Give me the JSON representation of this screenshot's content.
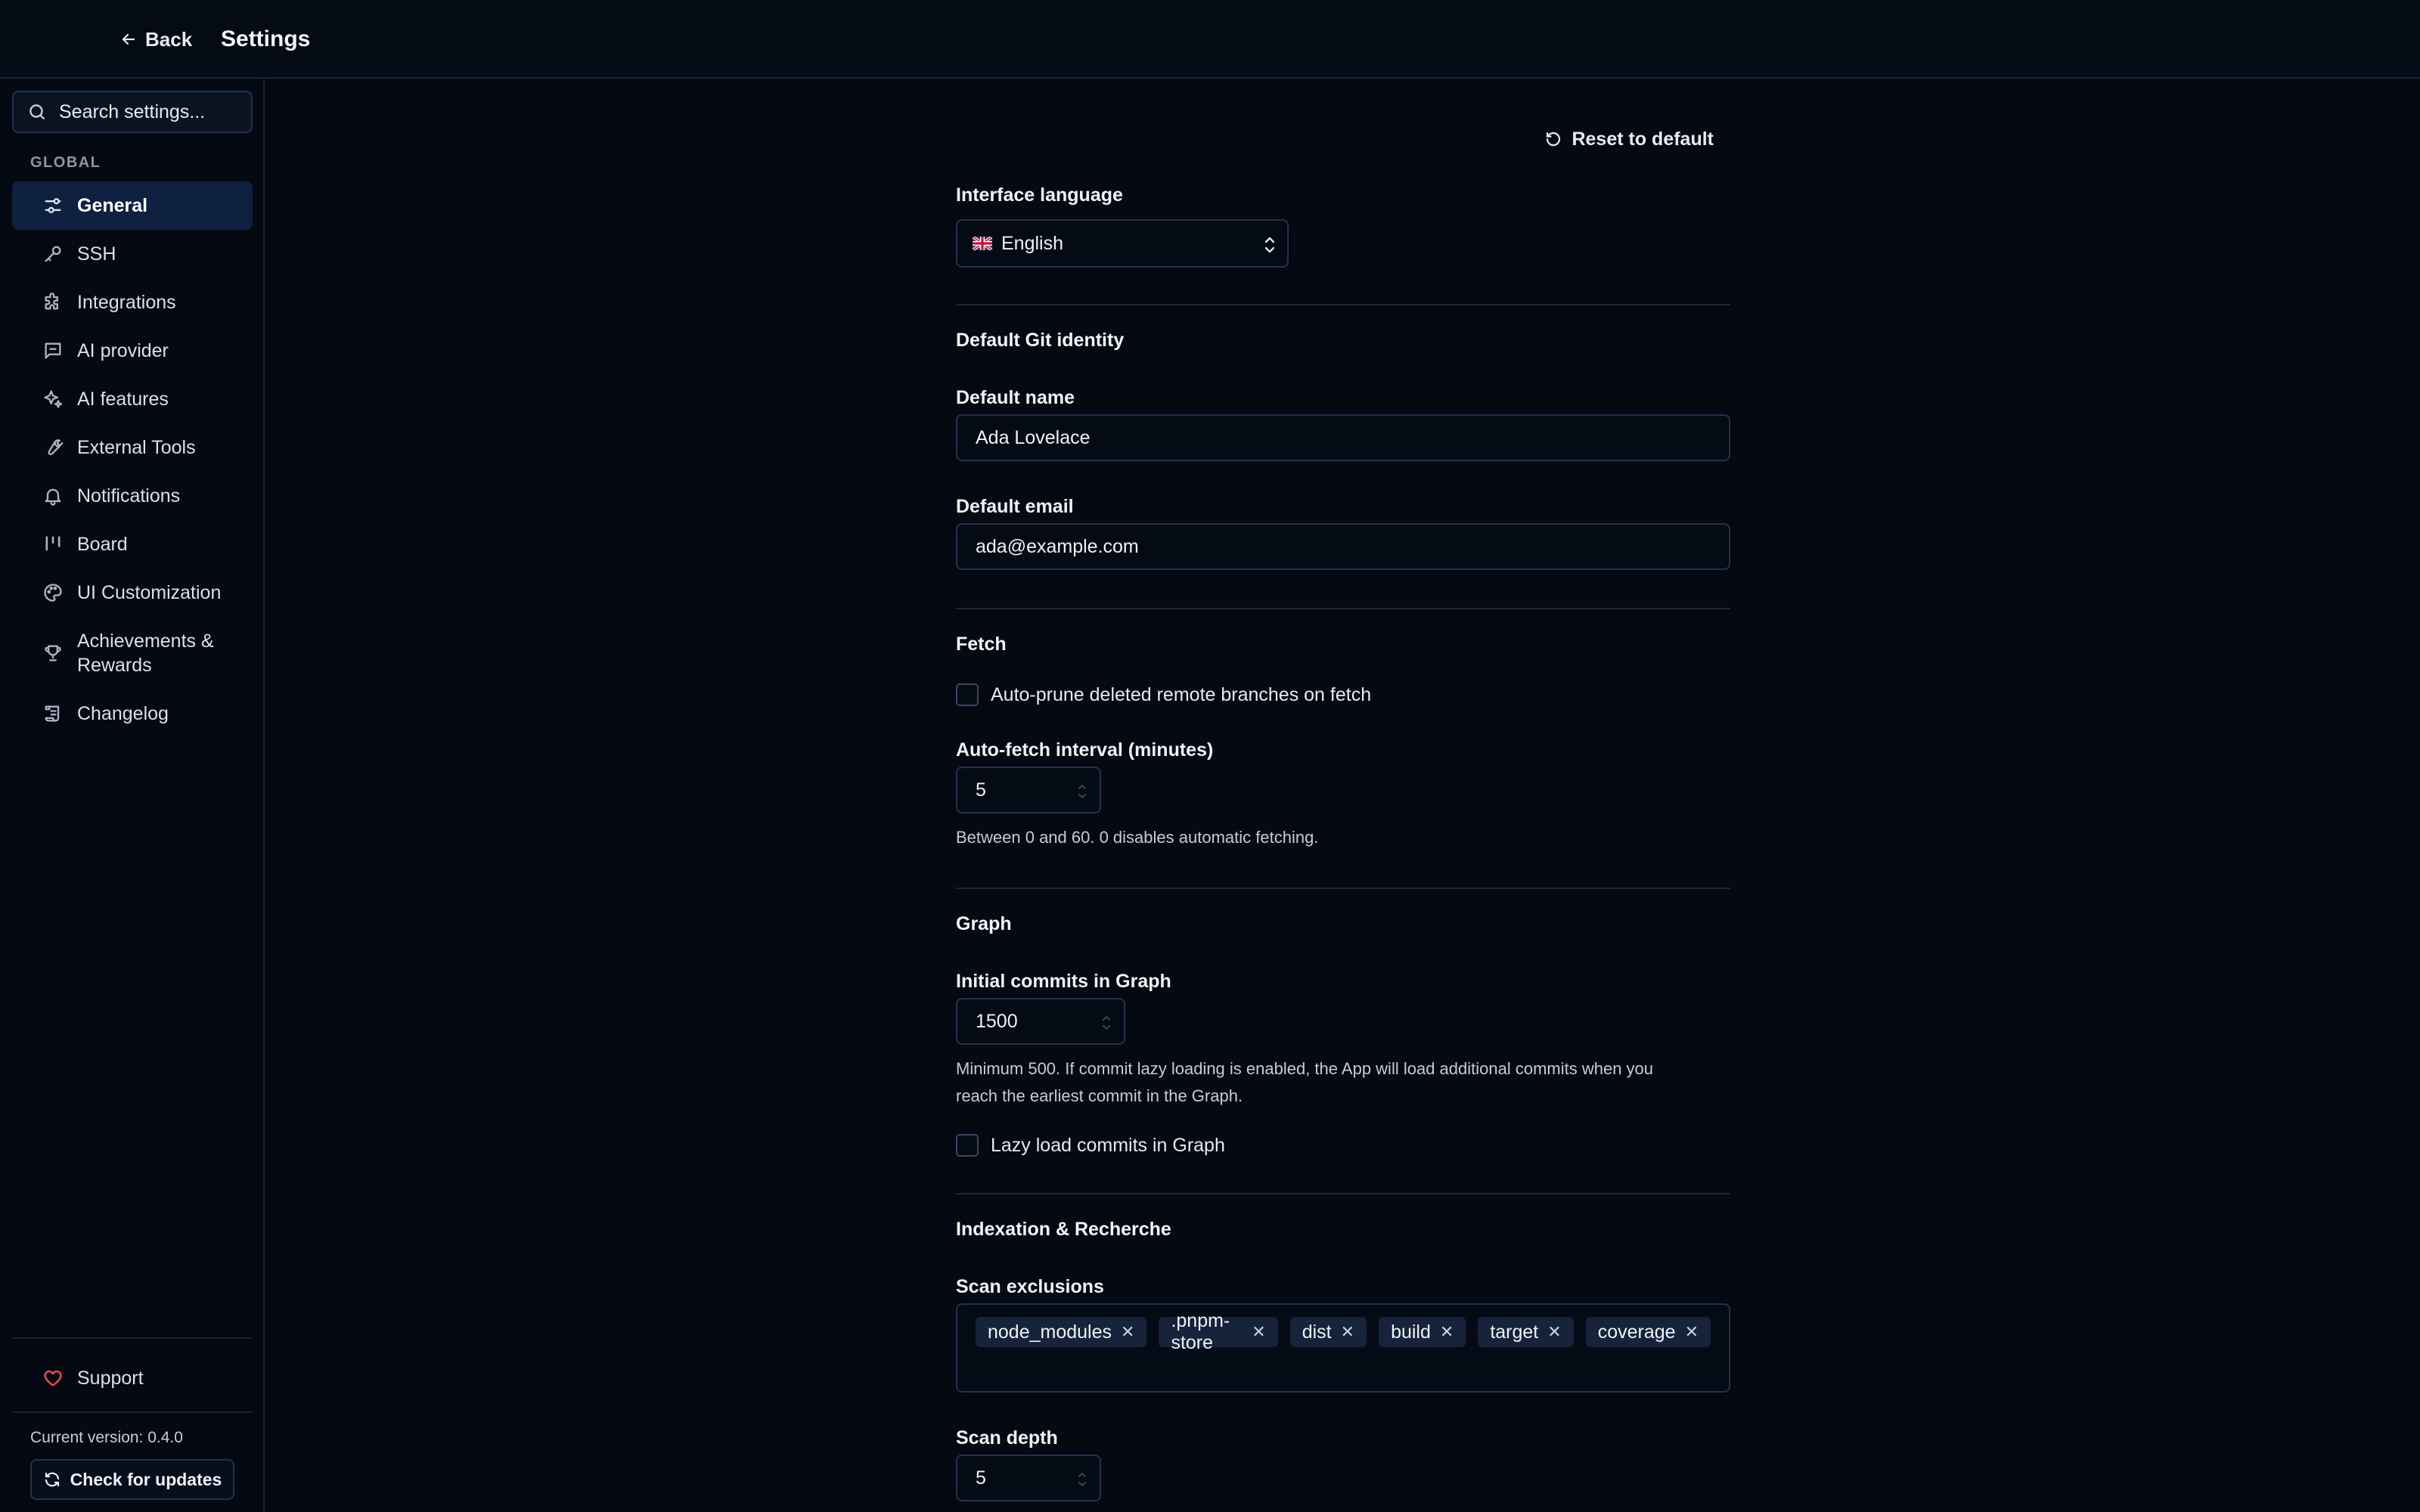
{
  "header": {
    "back_label": "Back",
    "title": "Settings"
  },
  "sidebar": {
    "search_placeholder": "Search settings...",
    "group_label": "GLOBAL",
    "items": [
      {
        "label": "General",
        "icon": "sliders-icon",
        "active": true
      },
      {
        "label": "SSH",
        "icon": "key-icon"
      },
      {
        "label": "Integrations",
        "icon": "puzzle-icon"
      },
      {
        "label": "AI provider",
        "icon": "message-square-icon"
      },
      {
        "label": "AI features",
        "icon": "sparkles-icon"
      },
      {
        "label": "External Tools",
        "icon": "wrench-icon"
      },
      {
        "label": "Notifications",
        "icon": "bell-icon"
      },
      {
        "label": "Board",
        "icon": "kanban-icon"
      },
      {
        "label": "UI Customization",
        "icon": "palette-icon"
      },
      {
        "label": "Achievements & Rewards",
        "icon": "trophy-icon"
      },
      {
        "label": "Changelog",
        "icon": "scroll-icon"
      }
    ],
    "support_label": "Support",
    "version_text": "Current version: 0.4.0",
    "check_updates_label": "Check for updates"
  },
  "main": {
    "reset_label": "Reset to default",
    "language": {
      "label": "Interface language",
      "value": "English"
    },
    "git_identity": {
      "title": "Default Git identity",
      "name_label": "Default name",
      "name_value": "Ada Lovelace",
      "email_label": "Default email",
      "email_value": "ada@example.com"
    },
    "fetch": {
      "title": "Fetch",
      "auto_prune_label": "Auto-prune deleted remote branches on fetch",
      "auto_prune_checked": false,
      "interval_label": "Auto-fetch interval (minutes)",
      "interval_value": "5",
      "interval_help": "Between 0 and 60. 0 disables automatic fetching."
    },
    "graph": {
      "title": "Graph",
      "initial_commits_label": "Initial commits in Graph",
      "initial_commits_value": "1500",
      "help_line1": "Minimum 500. If commit lazy loading is enabled, the App will load additional commits when you",
      "help_line2": "reach the earliest commit in the Graph.",
      "lazy_load_label": "Lazy load commits in Graph",
      "lazy_load_checked": false
    },
    "indexation": {
      "title": "Indexation & Recherche",
      "scan_exclusions_label": "Scan exclusions",
      "scan_exclusions": [
        "node_modules",
        ".pnpm-store",
        "dist",
        "build",
        "target",
        "coverage"
      ],
      "scan_depth_label": "Scan depth",
      "scan_depth_value": "5"
    }
  },
  "colors": {
    "background": "#040912",
    "active_nav": "#0f2140",
    "border": "#22324d",
    "support_heart": "#e5484d"
  }
}
